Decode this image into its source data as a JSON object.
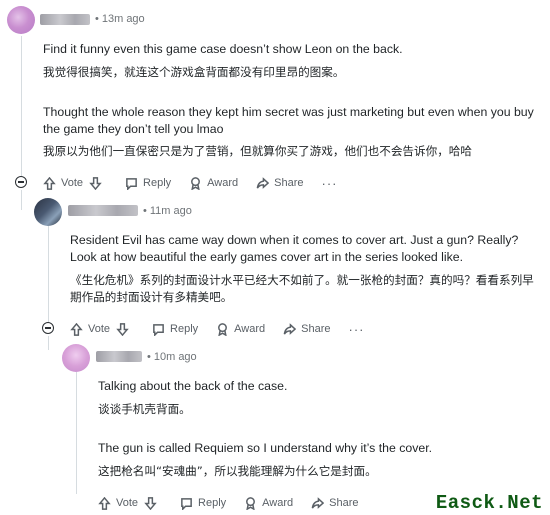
{
  "comments": [
    {
      "time": "13m ago",
      "paragraphs": [
        {
          "en": "Find it funny even this game case doesn’t show Leon on the back.",
          "cn": "我觉得很搞笑，就连这个游戏盒背面都没有印里昂的图案。"
        },
        {
          "en": "Thought the whole reason they kept him secret was just marketing but even when you buy the game they don’t tell you lmao",
          "cn": "我原以为他们一直保密只是为了营销，但就算你买了游戏，他们也不会告诉你，哈哈"
        }
      ]
    },
    {
      "time": "11m ago",
      "paragraphs": [
        {
          "en": "Resident Evil has came way down when it comes to cover art. Just a gun? Really? Look at how beautiful the early games cover art in the series looked like.",
          "cn": "《生化危机》系列的封面设计水平已经大不如前了。就一张枪的封面？真的吗？看看系列早期作品的封面设计有多精美吧。"
        }
      ]
    },
    {
      "time": "10m ago",
      "paragraphs": [
        {
          "en": "Talking about the back of the case.",
          "cn": "谈谈手机壳背面。"
        },
        {
          "en": "The gun is called Requiem so I understand why it’s the cover.",
          "cn": "这把枪名叫“安魂曲”，所以我能理解为什么它是封面。"
        }
      ]
    }
  ],
  "actions": {
    "vote": "Vote",
    "reply": "Reply",
    "award": "Award",
    "share": "Share",
    "more": "···"
  },
  "icons": [
    "upvote-icon",
    "downvote-icon",
    "reply-icon",
    "award-icon",
    "share-icon",
    "collapse-icon",
    "more-icon"
  ],
  "watermark": "Easck.Net",
  "colors": {
    "watermark": "#0f5a14",
    "meta": "#6f7478",
    "thread_line": "#d6dce0"
  }
}
